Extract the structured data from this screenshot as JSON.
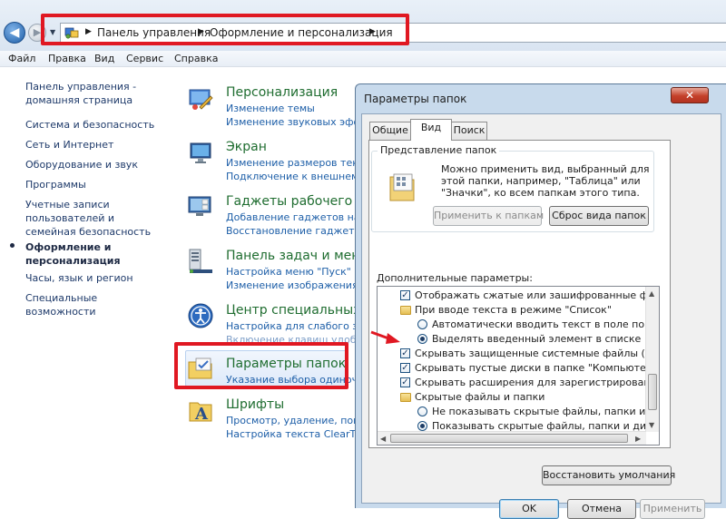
{
  "breadcrumb": {
    "items": [
      "Панель управления",
      "Оформление и персонализация"
    ]
  },
  "menubar": {
    "items": [
      "Файл",
      "Правка",
      "Вид",
      "Сервис",
      "Справка"
    ]
  },
  "leftnav": {
    "home": "Панель управления - домашняя страница",
    "items": [
      "Система и безопасность",
      "Сеть и Интернет",
      "Оборудование и звук",
      "Программы",
      "Учетные записи пользователей и семейная безопасность",
      "Оформление и персонализация",
      "Часы, язык и регион",
      "Специальные возможности"
    ]
  },
  "categories": [
    {
      "title": "Персонализация",
      "links": [
        "Изменение темы",
        "Изменение звуковых эффе"
      ]
    },
    {
      "title": "Экран",
      "links": [
        "Изменение размеров текст",
        "Подключение к внешнему"
      ]
    },
    {
      "title": "Гаджеты рабочего ст",
      "links": [
        "Добавление гаджетов на ра",
        "Восстановление гаджетов"
      ]
    },
    {
      "title": "Панель задач и меню",
      "links": [
        "Настройка меню \"Пуск\"",
        "Изменение изображения з"
      ]
    },
    {
      "title": "Центр специальных в",
      "links": [
        "Настройка для слабого зре",
        "Включение клавиш удобн"
      ]
    },
    {
      "title": "Параметры папок",
      "links": [
        "Указание выбора одиноч"
      ]
    },
    {
      "title": "Шрифты",
      "links": [
        "Просмотр, удаление, показ",
        "Настройка текста ClearType"
      ]
    }
  ],
  "dialog": {
    "title": "Параметры папок",
    "close_label": "✕",
    "tabs": [
      "Общие",
      "Вид",
      "Поиск"
    ],
    "group_title": "Представление папок",
    "group_text": "Можно применить вид, выбранный для этой папки, например, \"Таблица\" или \"Значки\", ко всем папкам этого типа.",
    "apply_to_folders": "Применить к папкам",
    "reset_folders": "Сброс вида папок",
    "advanced_label": "Дополнительные параметры:",
    "tree": [
      {
        "kind": "checkbox",
        "checked": true,
        "text": "Отображать сжатые или зашифрованные файлы NTI"
      },
      {
        "kind": "folder",
        "text": "При вводе текста в режиме \"Список\""
      },
      {
        "kind": "radio",
        "checked": false,
        "text": "Автоматически вводить текст в поле поиска"
      },
      {
        "kind": "radio",
        "checked": true,
        "text": "Выделять введенный элемент в списке"
      },
      {
        "kind": "checkbox",
        "checked": true,
        "text": "Скрывать защищенные системные файлы (рекомен"
      },
      {
        "kind": "checkbox",
        "checked": true,
        "text": "Скрывать пустые диски в папке \"Компьютер\""
      },
      {
        "kind": "checkbox",
        "checked": true,
        "text": "Скрывать расширения для зарегистрированных типо"
      },
      {
        "kind": "folder",
        "text": "Скрытые файлы и папки"
      },
      {
        "kind": "radio",
        "checked": false,
        "text": "Не показывать скрытые файлы, папки и диски"
      },
      {
        "kind": "radio",
        "checked": true,
        "text": "Показывать скрытые файлы, папки и диски"
      }
    ],
    "restore_defaults": "Восстановить умолчания",
    "ok": "OK",
    "cancel": "Отмена",
    "apply": "Применить"
  },
  "colors": {
    "highlight_red": "#e01822",
    "category_green": "#1f6d30",
    "link_blue": "#1e5fa8"
  }
}
